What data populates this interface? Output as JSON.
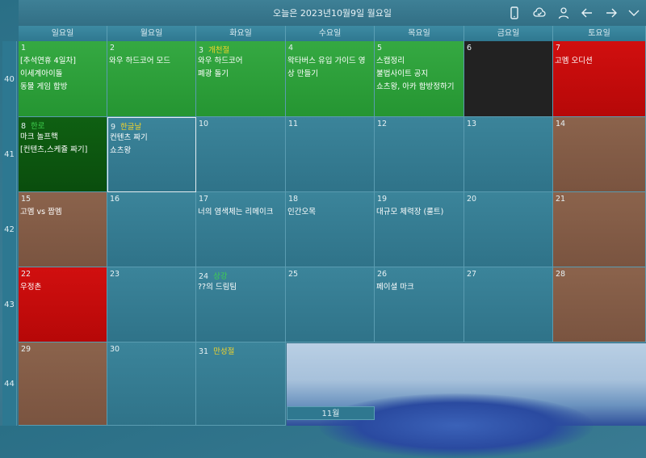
{
  "header": {
    "title": "오늘은 2023년10월9일 월요일",
    "icons": [
      "phone-icon",
      "sync-cloud-icon",
      "person-icon",
      "arrow-left-icon",
      "arrow-right-icon",
      "chevron-down-icon"
    ]
  },
  "weekdays": [
    "일요일",
    "월요일",
    "화요일",
    "수요일",
    "목요일",
    "금요일",
    "토요일"
  ],
  "week_numbers": [
    "40",
    "41",
    "42",
    "43",
    "44"
  ],
  "weeks": [
    [
      {
        "num": "1",
        "holiday": "",
        "events": [
          "[추석연휴 4일차]",
          "이세계아이돌",
          "동물 게임 합방"
        ],
        "style": "green"
      },
      {
        "num": "2",
        "holiday": "",
        "events": [
          "와우 하드코어 모드"
        ],
        "style": "green"
      },
      {
        "num": "3",
        "holiday": "개천절",
        "events": [
          "와우 하드코어",
          "폐광 돌기"
        ],
        "style": "green"
      },
      {
        "num": "4",
        "holiday": "",
        "events": [
          "왁타버스 유입 가이드 영",
          "상 만들기"
        ],
        "style": "green"
      },
      {
        "num": "5",
        "holiday": "",
        "events": [
          "스캡정리",
          "불법사이트 공지",
          "쇼츠왕, 아카 합방정하기"
        ],
        "style": "green"
      },
      {
        "num": "6",
        "holiday": "",
        "events": [],
        "style": "black"
      },
      {
        "num": "7",
        "holiday": "",
        "events": [
          "고멤 오디션"
        ],
        "style": "red"
      }
    ],
    [
      {
        "num": "8",
        "holiday": "한로",
        "events": [
          "마크 놀프핵",
          "[컨텐츠,스케쥴 짜기]"
        ],
        "style": "dkgreen"
      },
      {
        "num": "9",
        "holiday": "한글날",
        "events": [
          "컨텐츠 짜기",
          "쇼츠왕"
        ],
        "style": "selected"
      },
      {
        "num": "10",
        "holiday": "",
        "events": [],
        "style": ""
      },
      {
        "num": "11",
        "holiday": "",
        "events": [],
        "style": ""
      },
      {
        "num": "12",
        "holiday": "",
        "events": [],
        "style": ""
      },
      {
        "num": "13",
        "holiday": "",
        "events": [],
        "style": ""
      },
      {
        "num": "14",
        "holiday": "",
        "events": [],
        "style": "brown"
      }
    ],
    [
      {
        "num": "15",
        "holiday": "",
        "events": [
          "고멤 vs 짭멤"
        ],
        "style": "brown"
      },
      {
        "num": "16",
        "holiday": "",
        "events": [],
        "style": ""
      },
      {
        "num": "17",
        "holiday": "",
        "events": [
          "너의 염색체는 리메이크"
        ],
        "style": ""
      },
      {
        "num": "18",
        "holiday": "",
        "events": [
          "인간오목"
        ],
        "style": ""
      },
      {
        "num": "19",
        "holiday": "",
        "events": [
          "대규모 체력장 (룰트)"
        ],
        "style": ""
      },
      {
        "num": "20",
        "holiday": "",
        "events": [],
        "style": ""
      },
      {
        "num": "21",
        "holiday": "",
        "events": [],
        "style": "brown"
      }
    ],
    [
      {
        "num": "22",
        "holiday": "",
        "events": [
          "우정촌"
        ],
        "style": "red"
      },
      {
        "num": "23",
        "holiday": "",
        "events": [],
        "style": ""
      },
      {
        "num": "24",
        "holiday": "상강",
        "events": [
          "??의 드림팀"
        ],
        "style": ""
      },
      {
        "num": "25",
        "holiday": "",
        "events": [],
        "style": ""
      },
      {
        "num": "26",
        "holiday": "",
        "events": [
          "페이셜 마크"
        ],
        "style": ""
      },
      {
        "num": "27",
        "holiday": "",
        "events": [],
        "style": ""
      },
      {
        "num": "28",
        "holiday": "",
        "events": [],
        "style": "brown"
      }
    ],
    [
      {
        "num": "29",
        "holiday": "",
        "events": [],
        "style": "brown"
      },
      {
        "num": "30",
        "holiday": "",
        "events": [],
        "style": ""
      },
      {
        "num": "31",
        "holiday": "만성절",
        "events": [],
        "style": ""
      }
    ]
  ],
  "month_tab": "11월",
  "colors": {
    "accent_green": "#259532",
    "holiday_text": "#f2d42a",
    "weekend_red": "#c20b0b",
    "weekend_brown": "#7f5843"
  }
}
